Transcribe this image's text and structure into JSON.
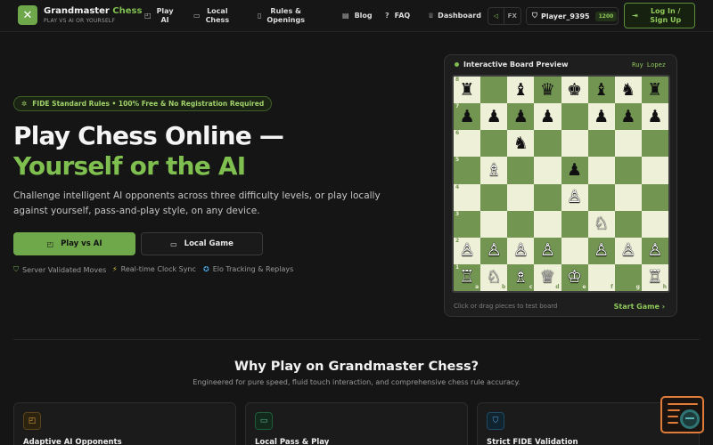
{
  "nav": {
    "brand_name": "Grandmaster",
    "brand_accent": "Chess",
    "brand_sub": "PLAY VS AI OR YOURSELF",
    "items": [
      {
        "label": "Play\nAI",
        "icon": "robot-icon"
      },
      {
        "label": "Local\nChess",
        "icon": "monitor-icon"
      },
      {
        "label": "Rules &\nOpenings",
        "icon": "book-icon"
      },
      {
        "label": "Blog",
        "icon": "newspaper-icon"
      },
      {
        "label": "FAQ",
        "icon": "help-circle-icon"
      },
      {
        "label": "Dashboard",
        "icon": "trophy-icon"
      }
    ],
    "sound_label": "FX",
    "player_name": "Player_9395",
    "player_elo": "1200",
    "login_label": "Log In / Sign Up"
  },
  "hero": {
    "badge": "FIDE Standard Rules • 100% Free & No Registration Required",
    "title_line1": "Play Chess Online —",
    "title_line2": "Yourself or the AI",
    "description": "Challenge intelligent AI opponents across three difficulty levels, or play locally against yourself, pass-and-play style, on any device.",
    "primary_button": "Play vs AI",
    "secondary_button": "Local Game",
    "features": [
      "Server Validated Moves",
      "Real-time Clock Sync",
      "Elo Tracking & Replays"
    ]
  },
  "preview": {
    "title": "Interactive Board Preview",
    "opening": "Ruy Lopez",
    "footer_hint": "Click or drag pieces to test board",
    "start_label": "Start Game ›",
    "board": [
      [
        "♜",
        "",
        "♝",
        "♛",
        "♚",
        "♝",
        "♞",
        "♜"
      ],
      [
        "♟",
        "♟",
        "♟",
        "♟",
        "",
        "♟",
        "♟",
        "♟"
      ],
      [
        "",
        "",
        "♞",
        "",
        "",
        "",
        "",
        ""
      ],
      [
        "",
        "♗",
        "",
        "",
        "♟",
        "",
        "",
        ""
      ],
      [
        "",
        "",
        "",
        "",
        "♙",
        "",
        "",
        ""
      ],
      [
        "",
        "",
        "",
        "",
        "",
        "♘",
        "",
        ""
      ],
      [
        "♙",
        "♙",
        "♙",
        "♙",
        "",
        "♙",
        "♙",
        "♙"
      ],
      [
        "♖",
        "♘",
        "♗",
        "♕",
        "♔",
        "",
        "",
        "♖"
      ]
    ],
    "ranks": [
      "8",
      "7",
      "6",
      "5",
      "4",
      "3",
      "2",
      "1"
    ],
    "files": [
      "a",
      "b",
      "c",
      "d",
      "e",
      "f",
      "g",
      "h"
    ]
  },
  "why": {
    "title": "Why Play on Grandmaster Chess?",
    "subtitle": "Engineered for pure speed, fluid touch interaction, and comprehensive chess rule accuracy.",
    "cards": [
      {
        "title": "Adaptive AI Opponents",
        "icon": "bot-icon",
        "color": "#d8a13c"
      },
      {
        "title": "Local Pass & Play",
        "icon": "monitor-icon",
        "color": "#5cc08a"
      },
      {
        "title": "Strict FIDE Validation",
        "icon": "shield-check-icon",
        "color": "#5aa7e0"
      }
    ]
  },
  "colors": {
    "accent": "#7fbf4f",
    "light_square": "#eef0d8",
    "dark_square": "#739552",
    "background": "#151515"
  }
}
